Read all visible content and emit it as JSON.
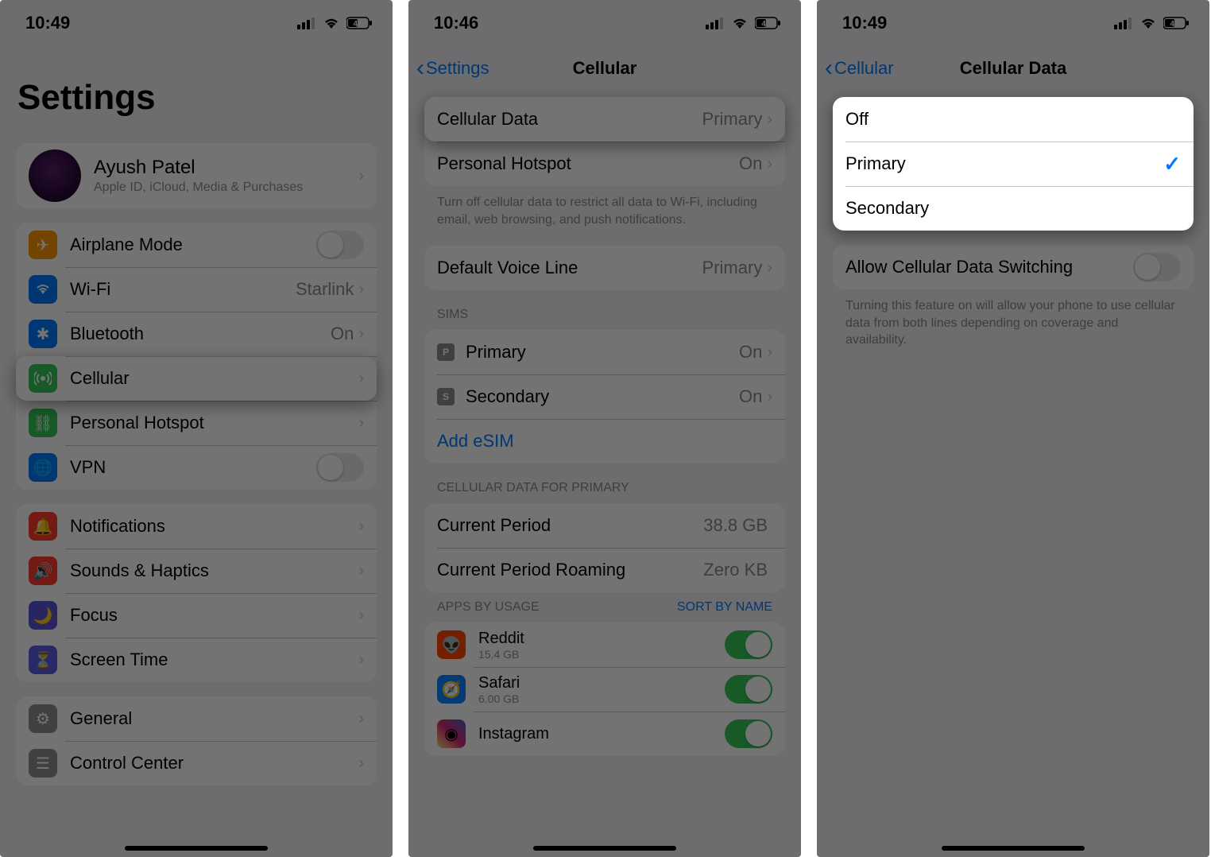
{
  "phones": {
    "p1": {
      "status": {
        "time": "10:49",
        "battery": "47"
      },
      "large_title": "Settings",
      "profile": {
        "name": "Ayush Patel",
        "detail": "Apple ID, iCloud, Media & Purchases"
      },
      "rows": {
        "airplane": "Airplane Mode",
        "wifi": "Wi-Fi",
        "wifi_val": "Starlink",
        "bluetooth": "Bluetooth",
        "bt_val": "On",
        "cellular": "Cellular",
        "hotspot": "Personal Hotspot",
        "vpn": "VPN",
        "notifications": "Notifications",
        "sounds": "Sounds & Haptics",
        "focus": "Focus",
        "screentime": "Screen Time",
        "general": "General",
        "controlcenter": "Control Center"
      }
    },
    "p2": {
      "status": {
        "time": "10:46",
        "battery": "47"
      },
      "nav": {
        "back": "Settings",
        "title": "Cellular"
      },
      "rows": {
        "cell_data": "Cellular Data",
        "cell_data_val": "Primary",
        "hotspot": "Personal Hotspot",
        "hotspot_val": "On",
        "footer1": "Turn off cellular data to restrict all data to Wi-Fi, including email, web browsing, and push notifications.",
        "voice": "Default Voice Line",
        "voice_val": "Primary",
        "sims_header": "SIMs",
        "sim_p": "Primary",
        "sim_p_badge": "P",
        "sim_p_val": "On",
        "sim_s": "Secondary",
        "sim_s_badge": "S",
        "sim_s_val": "On",
        "add_esim": "Add eSIM",
        "usage_header": "CELLULAR DATA FOR PRIMARY",
        "period": "Current Period",
        "period_val": "38.8 GB",
        "roaming": "Current Period Roaming",
        "roaming_val": "Zero KB",
        "apps_header": "APPS BY USAGE",
        "sort": "SORT BY NAME",
        "apps": [
          {
            "name": "Reddit",
            "size": "15.4 GB",
            "color": "#ff4500"
          },
          {
            "name": "Safari",
            "size": "6.00 GB",
            "color": "#0a84ff"
          },
          {
            "name": "Instagram",
            "size": "",
            "color": "#e1306c"
          }
        ]
      }
    },
    "p3": {
      "status": {
        "time": "10:49",
        "battery": "47"
      },
      "nav": {
        "back": "Cellular",
        "title": "Cellular Data"
      },
      "options": {
        "off": "Off",
        "primary": "Primary",
        "secondary": "Secondary"
      },
      "switching": {
        "label": "Allow Cellular Data Switching",
        "footer": "Turning this feature on will allow your phone to use cellular data from both lines depending on coverage and availability."
      }
    }
  }
}
